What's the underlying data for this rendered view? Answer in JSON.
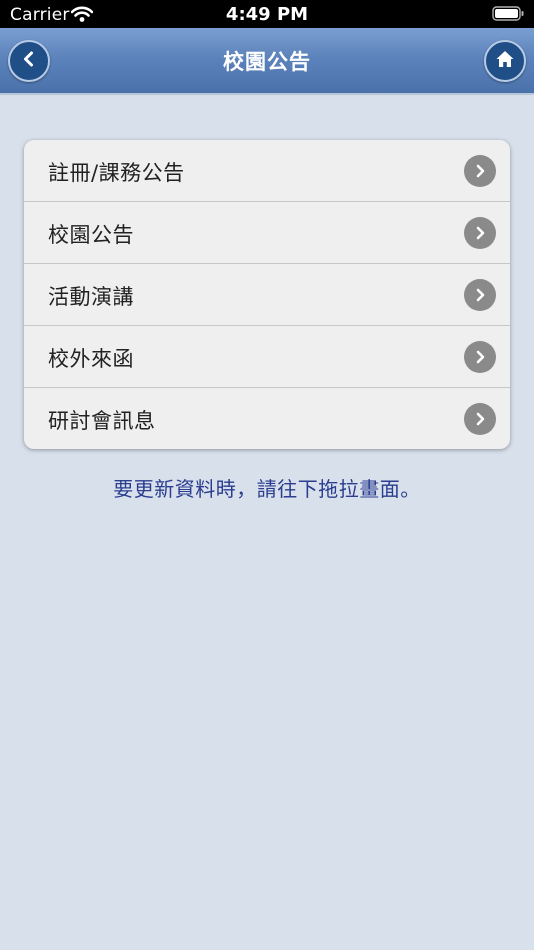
{
  "status_bar": {
    "carrier": "Carrier",
    "time": "4:49 PM"
  },
  "nav": {
    "title": "校園公告",
    "back_icon": "chevron-left-icon",
    "home_icon": "home-icon"
  },
  "menu": {
    "items": [
      {
        "label": "註冊/課務公告"
      },
      {
        "label": "校園公告"
      },
      {
        "label": "活動演講"
      },
      {
        "label": "校外來函"
      },
      {
        "label": "研討會訊息"
      }
    ]
  },
  "hint": "要更新資料時，請往下拖拉畫面。",
  "colors": {
    "background": "#d8e0ec",
    "nav_bar": "#5c83bb",
    "hint_text": "#2a3d8f"
  }
}
